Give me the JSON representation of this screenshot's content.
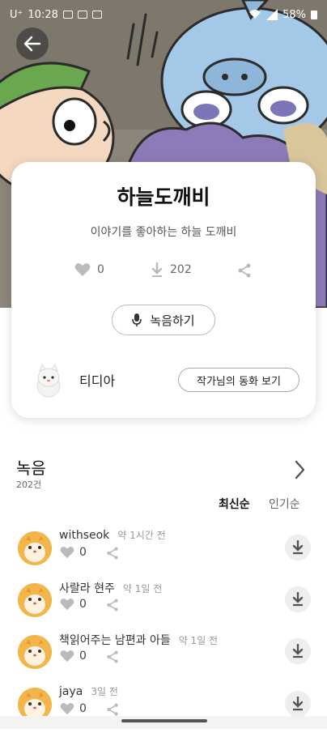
{
  "status_bar": {
    "carrier": "U⁺",
    "time": "10:28",
    "battery": "58%"
  },
  "story": {
    "title": "하늘도깨비",
    "subtitle": "이야기를 좋아하는 하늘 도깨비",
    "likes": "0",
    "downloads": "202",
    "record_label": "녹음하기"
  },
  "author": {
    "name": "티디아",
    "button_label": "작가님의 동화 보기"
  },
  "recordings": {
    "title": "녹음",
    "count": "202건",
    "sort_latest": "최신순",
    "sort_popular": "인기순",
    "items": [
      {
        "user": "withseok",
        "time": "약 1시간 전",
        "likes": "0"
      },
      {
        "user": "사랄라 현주",
        "time": "약 1일 전",
        "likes": "0"
      },
      {
        "user": "책읽어주는 남편과 아들",
        "time": "약 1일 전",
        "likes": "0"
      },
      {
        "user": "jaya",
        "time": "3일 전",
        "likes": "0"
      }
    ]
  },
  "icons": {
    "back": "arrow-left-icon",
    "heart": "heart-icon",
    "download": "download-icon",
    "share": "share-icon",
    "mic": "mic-icon",
    "chevron": "chevron-right-icon"
  }
}
